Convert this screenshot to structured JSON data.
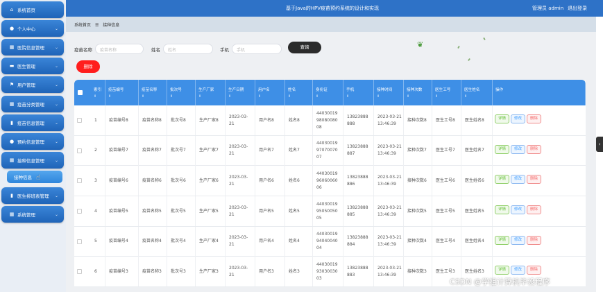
{
  "topbar": {
    "title": "基于Java的HPV疫苗预约系统的设计和实现",
    "user": "管理员 admin",
    "logout": "退出登录"
  },
  "sidebar": {
    "items": [
      {
        "label": "系统首页",
        "icon": "home-icon",
        "glyph": "⌂",
        "expandable": false
      },
      {
        "label": "个人中心",
        "icon": "user-icon",
        "glyph": "●",
        "expandable": true
      },
      {
        "label": "医院信息管理",
        "icon": "building-icon",
        "glyph": "▦",
        "expandable": true
      },
      {
        "label": "医生管理",
        "icon": "monitor-icon",
        "glyph": "▬",
        "expandable": true
      },
      {
        "label": "用户管理",
        "icon": "flag-icon",
        "glyph": "⚑",
        "expandable": true
      },
      {
        "label": "疫苗分类管理",
        "icon": "grid-icon",
        "glyph": "▦",
        "expandable": true
      },
      {
        "label": "疫苗信息管理",
        "icon": "chart-icon",
        "glyph": "▮",
        "expandable": true
      },
      {
        "label": "预约信息管理",
        "icon": "user-icon",
        "glyph": "●",
        "expandable": true
      },
      {
        "label": "接种信息管理",
        "icon": "grid-icon",
        "glyph": "▦",
        "expandable": true
      },
      {
        "label": "医生排班表管理",
        "icon": "chart-icon",
        "glyph": "▮",
        "expandable": true
      },
      {
        "label": "系统管理",
        "icon": "grid-icon",
        "glyph": "▦",
        "expandable": true
      }
    ],
    "active_sub": "接种信息"
  },
  "breadcrumb": {
    "home": "系统首页",
    "sep": "☰",
    "current": "接种信息"
  },
  "search": {
    "vaccine_label": "疫苗名称",
    "vaccine_placeholder": "疫苗名称",
    "name_label": "姓名",
    "name_placeholder": "姓名",
    "phone_label": "手机",
    "phone_placeholder": "手机",
    "query_button": "查询"
  },
  "delete_button": "删除",
  "table": {
    "headers": [
      "索引",
      "疫苗编号",
      "疫苗名称",
      "批次号",
      "生产厂家",
      "生产日期",
      "用户名",
      "姓名",
      "身份证",
      "手机",
      "接种时间",
      "接种次数",
      "医生工号",
      "医生姓名",
      "操作"
    ],
    "sort_glyph": "⇕",
    "actions": {
      "detail": "详情",
      "edit": "修改",
      "delete": "删除"
    },
    "rows": [
      {
        "idx": "1",
        "code": "疫苗编号8",
        "name": "疫苗名称8",
        "batch": "批次号8",
        "maker": "生产厂家8",
        "date": "2023-03-21",
        "user": "用户名8",
        "person": "姓名8",
        "id": "440300199808008008",
        "phone": "13823888888",
        "time": "2023-03-21 13:46:39",
        "count": "接种次数8",
        "doc_no": "医生工号8",
        "doc_name": "医生姓名8"
      },
      {
        "idx": "2",
        "code": "疫苗编号7",
        "name": "疫苗名称7",
        "batch": "批次号7",
        "maker": "生产厂家7",
        "date": "2023-03-21",
        "user": "用户名7",
        "person": "姓名7",
        "id": "440300199707007007",
        "phone": "13823888887",
        "time": "2023-03-21 13:46:39",
        "count": "接种次数7",
        "doc_no": "医生工号7",
        "doc_name": "医生姓名7"
      },
      {
        "idx": "3",
        "code": "疫苗编号6",
        "name": "疫苗名称6",
        "batch": "批次号6",
        "maker": "生产厂家6",
        "date": "2023-03-21",
        "user": "用户名6",
        "person": "姓名6",
        "id": "440300199606006006",
        "phone": "13823888886",
        "time": "2023-03-21 13:46:39",
        "count": "接种次数6",
        "doc_no": "医生工号6",
        "doc_name": "医生姓名6"
      },
      {
        "idx": "4",
        "code": "疫苗编号5",
        "name": "疫苗名称5",
        "batch": "批次号5",
        "maker": "生产厂家5",
        "date": "2023-03-21",
        "user": "用户名5",
        "person": "姓名5",
        "id": "440300199505005005",
        "phone": "13823888885",
        "time": "2023-03-21 13:46:39",
        "count": "接种次数5",
        "doc_no": "医生工号5",
        "doc_name": "医生姓名5"
      },
      {
        "idx": "5",
        "code": "疫苗编号4",
        "name": "疫苗名称4",
        "batch": "批次号4",
        "maker": "生产厂家4",
        "date": "2023-03-21",
        "user": "用户名4",
        "person": "姓名4",
        "id": "440300199404004004",
        "phone": "13823888884",
        "time": "2023-03-21 13:46:39",
        "count": "接种次数4",
        "doc_no": "医生工号4",
        "doc_name": "医生姓名4"
      },
      {
        "idx": "6",
        "code": "疫苗编号3",
        "name": "疫苗名称3",
        "batch": "批次号3",
        "maker": "生产厂家3",
        "date": "2023-03-21",
        "user": "用户名3",
        "person": "姓名3",
        "id": "440300199303003003",
        "phone": "13823888883",
        "time": "2023-03-21 13:46:39",
        "count": "接种次数3",
        "doc_no": "医生工号3",
        "doc_name": "医生姓名3"
      }
    ]
  },
  "collapse_glyph": "‹",
  "watermark": "CSDN @学姐计算机毕设程序",
  "colors": {
    "primary": "#2e72c7",
    "header": "#3e8fe6",
    "danger": "#ff1e1e"
  }
}
